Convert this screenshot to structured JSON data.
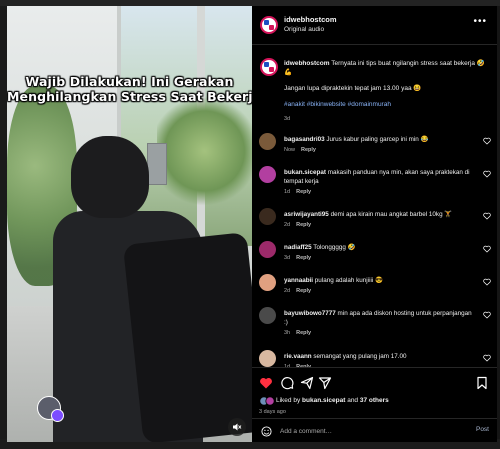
{
  "video": {
    "caption_line1": "Wajib Dilakukan! Ini Gerakan",
    "caption_line2": "Menghilangkan Stress Saat Bekerja"
  },
  "header": {
    "username": "idwebhostcom",
    "audio": "Original audio"
  },
  "post": {
    "username": "idwebhostcom",
    "text": "Ternyata ini tips buat ngilangin stress saat bekerja 🤣💪",
    "line2": "Jangan lupa dipraktekin tepat jam 13.00 yaa 😆",
    "hashtags": "#anakit #bikinwebsite #domainmurah",
    "time": "3d"
  },
  "reply_label": "Reply",
  "comments": [
    {
      "username": "bagasandri03",
      "text": "Jurus kabur paling garcep ini min 😂",
      "time": "Now",
      "avatar_color": "#7a5a3a"
    },
    {
      "username": "bukan.sicepat",
      "text": "makasih panduan nya min, akan saya praktekan di tempat kerja",
      "time": "1d",
      "avatar_color": "#b23fa0"
    },
    {
      "username": "asriwijayanti95",
      "text": "demi apa kirain mau angkat barbel 10kg 🏋",
      "time": "2d",
      "avatar_color": "#3a2a1e"
    },
    {
      "username": "nadiaff25",
      "text": "Tolonggggg 🤣",
      "time": "3d",
      "avatar_color": "#9c2a6a"
    },
    {
      "username": "yannaabii",
      "text": "pulang adalah kunjiiii 😎",
      "time": "2d",
      "avatar_color": "#e0a080"
    },
    {
      "username": "bayuwibowo7777",
      "text": "min apa ada diskon hosting untuk perpanjangan :)",
      "time": "3h",
      "avatar_color": "#4a4a4a"
    },
    {
      "username": "rie.vaann",
      "text": "semangat yang pulang jam 17.00",
      "time": "1d",
      "avatar_color": "#d8b8a0"
    }
  ],
  "likes": {
    "prefix": "Liked by",
    "user": "bukan.sicepat",
    "and": "and",
    "others": "37 others"
  },
  "date": "3 days ago",
  "composer": {
    "placeholder": "Add a comment…",
    "post_label": "Post"
  },
  "colors": {
    "like_red": "#ff3040",
    "hashtag_blue": "#8ab4f8",
    "muted": "#a8a8a8"
  }
}
